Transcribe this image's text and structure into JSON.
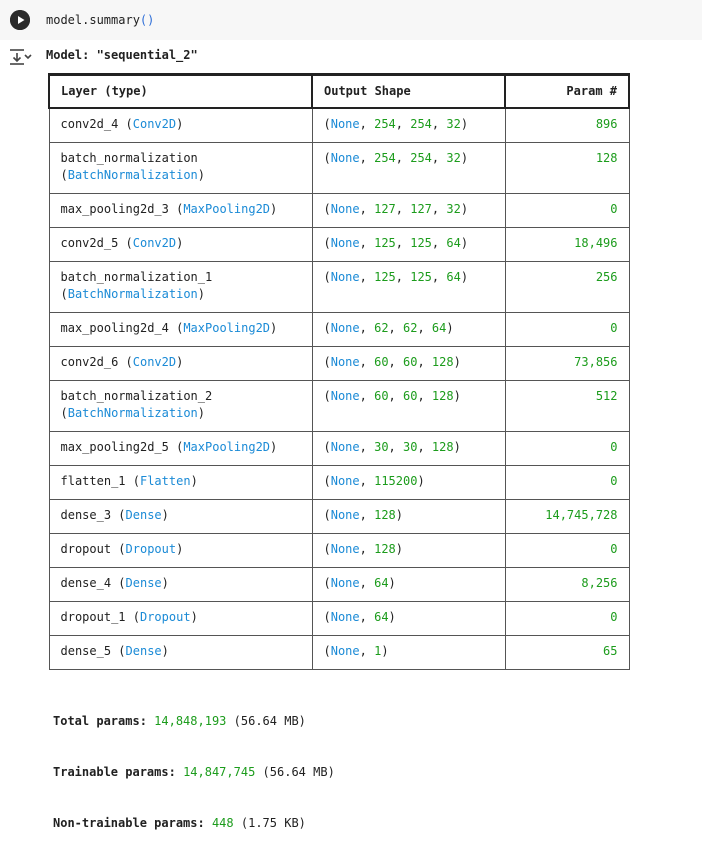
{
  "input": {
    "code_text": "model.summary",
    "code_parens": "()"
  },
  "output": {
    "title": "Model: \"sequential_2\""
  },
  "table": {
    "headers": [
      "Layer (type)",
      "Output Shape",
      "Param #"
    ],
    "rows": [
      {
        "name": "conv2d_4",
        "cls": "Conv2D",
        "wrap": false,
        "shape_pre": "(",
        "shape_none": "None",
        "shape_rest": ", 254, 254, 32)",
        "params": "896"
      },
      {
        "name": "batch_normalization",
        "cls": "BatchNormalization",
        "wrap": true,
        "shape_pre": "(",
        "shape_none": "None",
        "shape_rest": ", 254, 254, 32)",
        "params": "128"
      },
      {
        "name": "max_pooling2d_3",
        "cls": "MaxPooling2D",
        "wrap": false,
        "shape_pre": "(",
        "shape_none": "None",
        "shape_rest": ", 127, 127, 32)",
        "params": "0"
      },
      {
        "name": "conv2d_5",
        "cls": "Conv2D",
        "wrap": false,
        "shape_pre": "(",
        "shape_none": "None",
        "shape_rest": ", 125, 125, 64)",
        "params": "18,496"
      },
      {
        "name": "batch_normalization_1",
        "cls": "BatchNormalization",
        "wrap": true,
        "shape_pre": "(",
        "shape_none": "None",
        "shape_rest": ", 125, 125, 64)",
        "params": "256"
      },
      {
        "name": "max_pooling2d_4",
        "cls": "MaxPooling2D",
        "wrap": false,
        "shape_pre": "(",
        "shape_none": "None",
        "shape_rest": ", 62, 62, 64)",
        "params": "0"
      },
      {
        "name": "conv2d_6",
        "cls": "Conv2D",
        "wrap": false,
        "shape_pre": "(",
        "shape_none": "None",
        "shape_rest": ", 60, 60, 128)",
        "params": "73,856"
      },
      {
        "name": "batch_normalization_2",
        "cls": "BatchNormalization",
        "wrap": true,
        "shape_pre": "(",
        "shape_none": "None",
        "shape_rest": ", 60, 60, 128)",
        "params": "512"
      },
      {
        "name": "max_pooling2d_5",
        "cls": "MaxPooling2D",
        "wrap": false,
        "shape_pre": "(",
        "shape_none": "None",
        "shape_rest": ", 30, 30, 128)",
        "params": "0"
      },
      {
        "name": "flatten_1",
        "cls": "Flatten",
        "wrap": false,
        "shape_pre": "(",
        "shape_none": "None",
        "shape_rest": ", 115200)",
        "params": "0"
      },
      {
        "name": "dense_3",
        "cls": "Dense",
        "wrap": false,
        "shape_pre": "(",
        "shape_none": "None",
        "shape_rest": ", 128)",
        "params": "14,745,728"
      },
      {
        "name": "dropout",
        "cls": "Dropout",
        "wrap": false,
        "shape_pre": "(",
        "shape_none": "None",
        "shape_rest": ", 128)",
        "params": "0"
      },
      {
        "name": "dense_4",
        "cls": "Dense",
        "wrap": false,
        "shape_pre": "(",
        "shape_none": "None",
        "shape_rest": ", 64)",
        "params": "8,256"
      },
      {
        "name": "dropout_1",
        "cls": "Dropout",
        "wrap": false,
        "shape_pre": "(",
        "shape_none": "None",
        "shape_rest": ", 64)",
        "params": "0"
      },
      {
        "name": "dense_5",
        "cls": "Dense",
        "wrap": false,
        "shape_pre": "(",
        "shape_none": "None",
        "shape_rest": ", 1)",
        "params": "65"
      }
    ]
  },
  "totals": {
    "total_label": "Total params:",
    "total_value": "14,848,193",
    "total_size": "(56.64 MB)",
    "trainable_label": "Trainable params:",
    "trainable_value": "14,847,745",
    "trainable_size": "(56.64 MB)",
    "nontrainable_label": "Non-trainable params:",
    "nontrainable_value": "448",
    "nontrainable_size": "(1.75 KB)"
  },
  "colors": {
    "class_name": "#1a8ad6",
    "number": "#1c9c1c",
    "input_bg": "#f7f7f7"
  },
  "icons": {
    "run": "play-icon",
    "output": "output-collapse-icon"
  }
}
